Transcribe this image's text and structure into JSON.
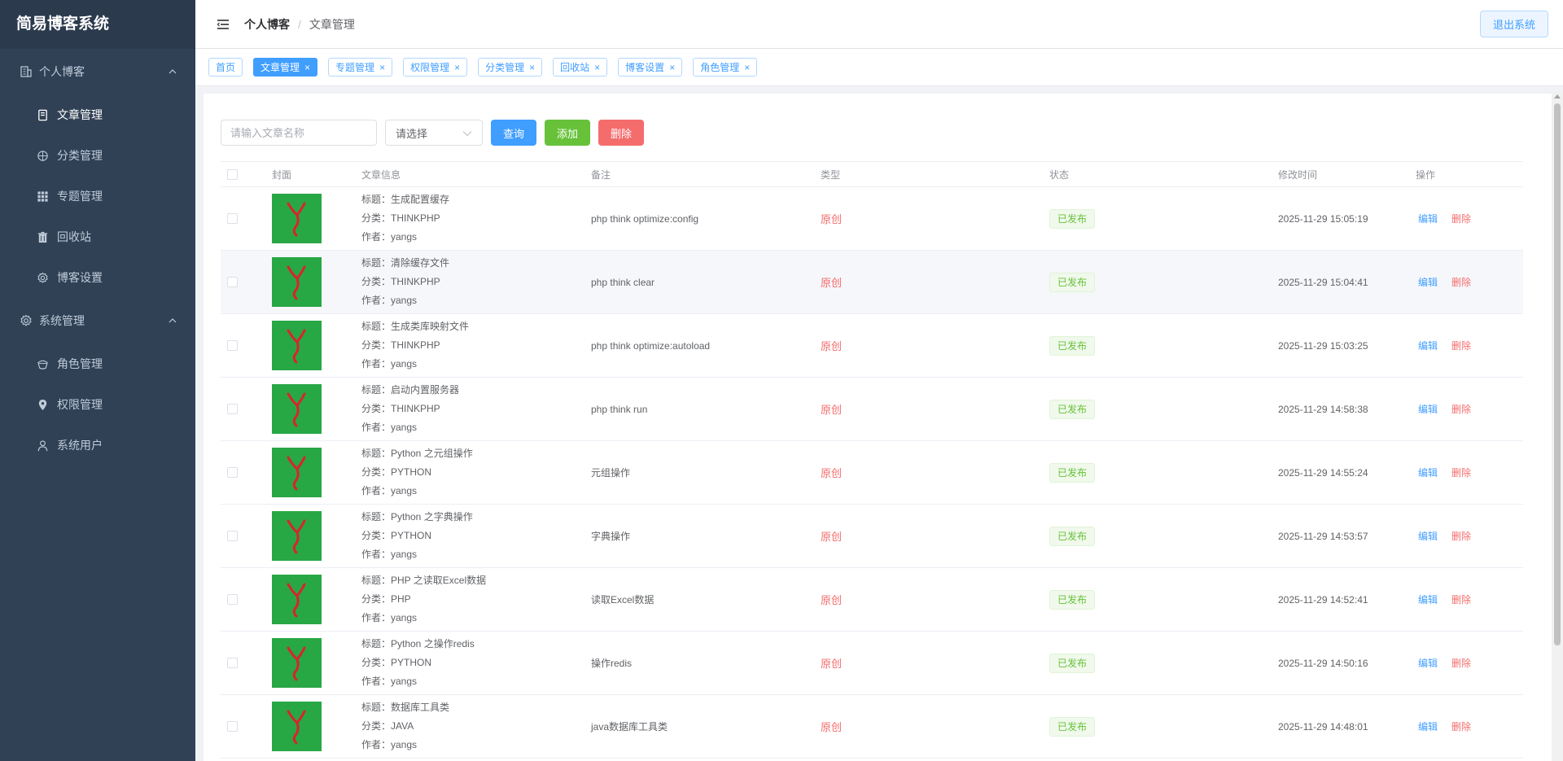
{
  "app": {
    "title": "简易博客系统"
  },
  "sidebar": {
    "groups": [
      {
        "label": "个人博客",
        "icon": "building-icon",
        "items": [
          {
            "label": "文章管理",
            "icon": "document-icon",
            "active": true
          },
          {
            "label": "分类管理",
            "icon": "compass-icon"
          },
          {
            "label": "专题管理",
            "icon": "grid-icon"
          },
          {
            "label": "回收站",
            "icon": "trash-icon"
          },
          {
            "label": "博客设置",
            "icon": "gear-icon"
          }
        ]
      },
      {
        "label": "系统管理",
        "icon": "gear-icon",
        "items": [
          {
            "label": "角色管理",
            "icon": "role-icon"
          },
          {
            "label": "权限管理",
            "icon": "location-pin-icon"
          },
          {
            "label": "系统用户",
            "icon": "user-icon"
          }
        ]
      }
    ]
  },
  "header": {
    "breadcrumb": [
      "个人博客",
      "文章管理"
    ],
    "breadcrumb_separator": "/",
    "logout_label": "退出系统"
  },
  "tags": [
    {
      "label": "首页",
      "closable": false
    },
    {
      "label": "文章管理",
      "closable": true,
      "active": true
    },
    {
      "label": "专题管理",
      "closable": true
    },
    {
      "label": "权限管理",
      "closable": true
    },
    {
      "label": "分类管理",
      "closable": true
    },
    {
      "label": "回收站",
      "closable": true
    },
    {
      "label": "博客设置",
      "closable": true
    },
    {
      "label": "角色管理",
      "closable": true
    }
  ],
  "toolbar": {
    "search_placeholder": "请输入文章名称",
    "select_placeholder": "请选择",
    "query_label": "查询",
    "add_label": "添加",
    "delete_label": "删除"
  },
  "table": {
    "columns": [
      "封面",
      "文章信息",
      "备注",
      "类型",
      "状态",
      "修改时间",
      "操作"
    ],
    "edit_label": "编辑",
    "delete_label": "删除",
    "rows": [
      {
        "title": "标题：生成配置缓存",
        "category": "分类：THINKPHP",
        "author": "作者：yangs",
        "note": "php think optimize:config",
        "type": "原创",
        "status": "已发布",
        "time": "2025-11-29 15:05:19"
      },
      {
        "title": "标题：清除缓存文件",
        "category": "分类：THINKPHP",
        "author": "作者：yangs",
        "note": "php think clear",
        "type": "原创",
        "status": "已发布",
        "time": "2025-11-29 15:04:41"
      },
      {
        "title": "标题：生成类库映射文件",
        "category": "分类：THINKPHP",
        "author": "作者：yangs",
        "note": "php think optimize:autoload",
        "type": "原创",
        "status": "已发布",
        "time": "2025-11-29 15:03:25"
      },
      {
        "title": "标题：启动内置服务器",
        "category": "分类：THINKPHP",
        "author": "作者：yangs",
        "note": "php think run",
        "type": "原创",
        "status": "已发布",
        "time": "2025-11-29 14:58:38"
      },
      {
        "title": "标题：Python 之元组操作",
        "category": "分类：PYTHON",
        "author": "作者：yangs",
        "note": "元组操作",
        "type": "原创",
        "status": "已发布",
        "time": "2025-11-29 14:55:24"
      },
      {
        "title": "标题：Python 之字典操作",
        "category": "分类：PYTHON",
        "author": "作者：yangs",
        "note": "字典操作",
        "type": "原创",
        "status": "已发布",
        "time": "2025-11-29 14:53:57"
      },
      {
        "title": "标题：PHP 之读取Excel数据",
        "category": "分类：PHP",
        "author": "作者：yangs",
        "note": "读取Excel数据",
        "type": "原创",
        "status": "已发布",
        "time": "2025-11-29 14:52:41"
      },
      {
        "title": "标题：Python 之操作redis",
        "category": "分类：PYTHON",
        "author": "作者：yangs",
        "note": "操作redis",
        "type": "原创",
        "status": "已发布",
        "time": "2025-11-29 14:50:16"
      },
      {
        "title": "标题：数据库工具类",
        "category": "分类：JAVA",
        "author": "作者：yangs",
        "note": "java数据库工具类",
        "type": "原创",
        "status": "已发布",
        "time": "2025-11-29 14:48:01"
      }
    ]
  },
  "colors": {
    "sidebar_bg": "#304156",
    "primary": "#409eff",
    "success": "#67c23a",
    "danger": "#f56c6c",
    "cover_bg": "#28a745"
  }
}
